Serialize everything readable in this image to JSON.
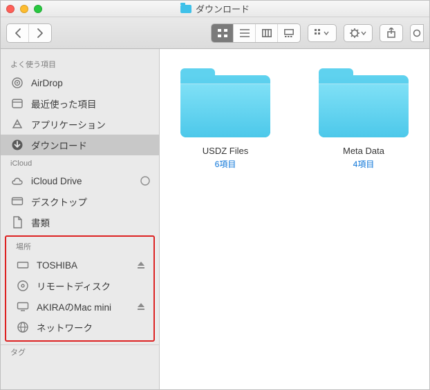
{
  "window": {
    "title": "ダウンロード"
  },
  "sidebar": {
    "sections": {
      "favorites": {
        "header": "よく使う項目",
        "items": [
          {
            "label": "AirDrop"
          },
          {
            "label": "最近使った項目"
          },
          {
            "label": "アプリケーション"
          },
          {
            "label": "ダウンロード"
          }
        ]
      },
      "icloud": {
        "header": "iCloud",
        "items": [
          {
            "label": "iCloud Drive"
          },
          {
            "label": "デスクトップ"
          },
          {
            "label": "書類"
          }
        ]
      },
      "locations": {
        "header": "場所",
        "items": [
          {
            "label": "TOSHIBA"
          },
          {
            "label": "リモートディスク"
          },
          {
            "label": "AKIRAのMac mini"
          },
          {
            "label": "ネットワーク"
          }
        ]
      }
    },
    "tags_label": "タグ"
  },
  "content": {
    "items": [
      {
        "name": "USDZ Files",
        "count": "6項目"
      },
      {
        "name": "Meta Data",
        "count": "4項目"
      }
    ]
  }
}
